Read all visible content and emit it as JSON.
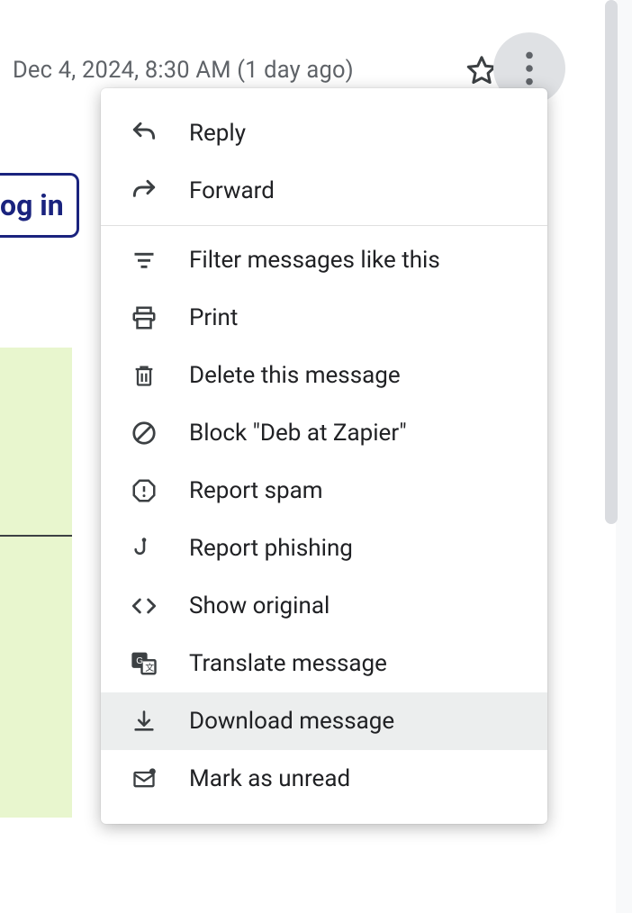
{
  "message": {
    "timestamp": "Dec 4, 2024, 8:30 AM (1 day ago)"
  },
  "login_button": {
    "label": "og in"
  },
  "menu": {
    "reply": "Reply",
    "forward": "Forward",
    "filter": "Filter messages like this",
    "print": "Print",
    "delete": "Delete this message",
    "block": "Block \"Deb at Zapier\"",
    "report_spam": "Report spam",
    "report_phishing": "Report phishing",
    "show_original": "Show original",
    "translate": "Translate message",
    "download": "Download message",
    "mark_unread": "Mark as unread"
  }
}
